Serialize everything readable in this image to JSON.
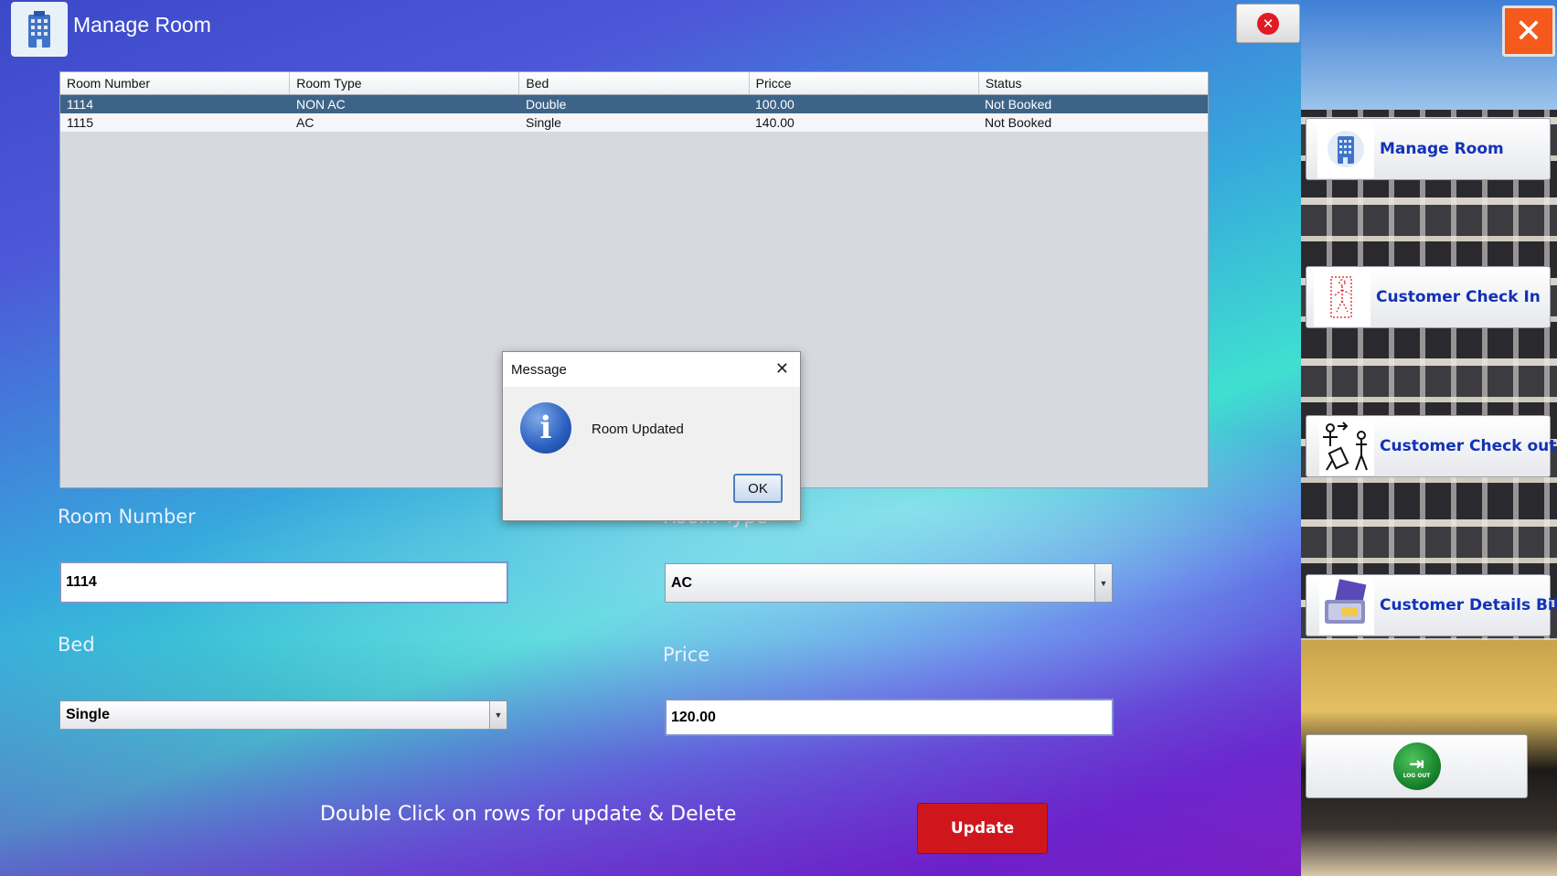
{
  "header": {
    "title": "Manage Room",
    "icon": "hotel-building-icon",
    "close_icon": "red-circle-x-icon"
  },
  "table": {
    "columns": [
      "Room Number",
      "Room Type",
      "Bed",
      "Pricce",
      "Status"
    ],
    "rows": [
      [
        "1114",
        "NON AC",
        "Double",
        "100.00",
        "Not Booked"
      ],
      [
        "1115",
        "AC",
        "Single",
        "140.00",
        "Not Booked"
      ]
    ],
    "selected_row": 0,
    "colors": {
      "selected": "#3d6488"
    }
  },
  "form": {
    "room_number_label": "Room Number",
    "room_number_value": "1114",
    "room_type_label": "Room Type",
    "room_type_value": "AC",
    "bed_label": "Bed",
    "bed_value": "Single",
    "price_label": "Price",
    "price_value": "120.00"
  },
  "hint": "Double Click on rows for update & Delete",
  "update_label": "Update",
  "dialog": {
    "title": "Message",
    "message": "Room Updated",
    "ok_label": "OK",
    "icon": "info-icon"
  },
  "sidebar": {
    "close_icon": "close-x-icon",
    "items": [
      {
        "label": "Manage Room",
        "icon": "hotel-building-icon"
      },
      {
        "label": "Customer Check In",
        "icon": "check-in-door-icon"
      },
      {
        "label": "Customer Check out",
        "icon": "check-out-traveler-icon"
      },
      {
        "label": "Customer Details Bill",
        "icon": "bill-payment-icon"
      }
    ],
    "logout": {
      "icon": "logout-icon",
      "icon_text": "LOG OUT"
    }
  },
  "colors": {
    "update_button": "#d0161d",
    "nav_text": "#1232b8",
    "close_orange": "#f55a1c"
  }
}
